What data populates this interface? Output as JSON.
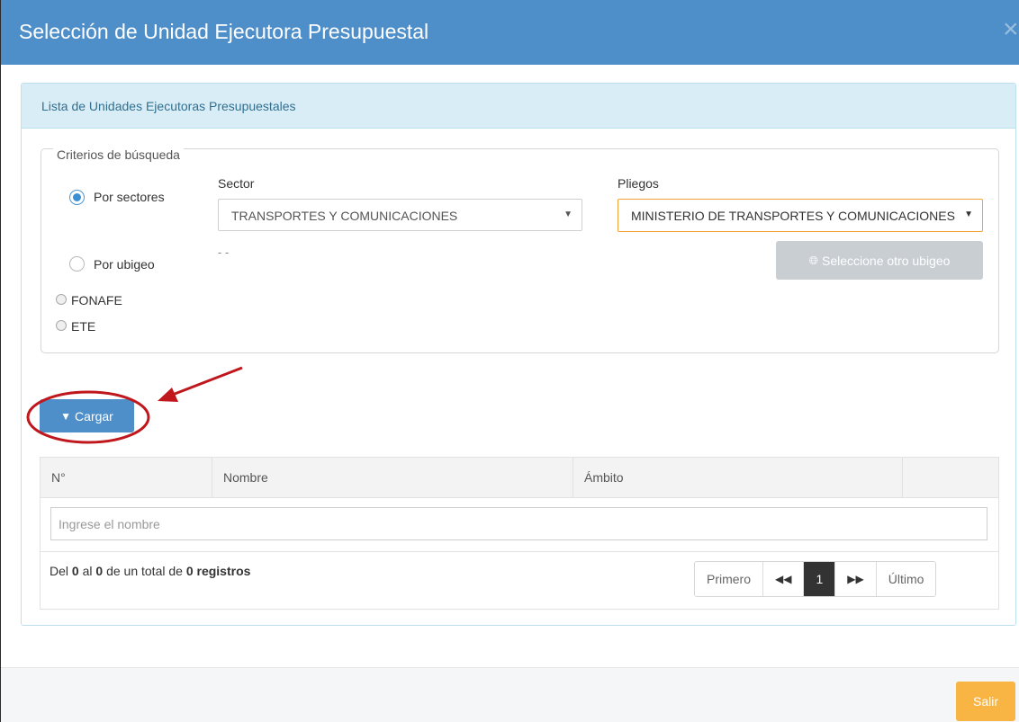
{
  "modal": {
    "title": "Selección de Unidad Ejecutora Presupuestal",
    "close_icon": "close-icon"
  },
  "panel": {
    "title": "Lista de Unidades Ejecutoras Presupuestales"
  },
  "criteria": {
    "legend": "Criterios de búsqueda",
    "radio_sectores": "Por sectores",
    "radio_ubigeo": "Por ubigeo",
    "radio_fonafe": "FONAFE",
    "radio_ete": "ETE",
    "selected_radio": "Por sectores",
    "sector_label": "Sector",
    "sector_value": "TRANSPORTES Y COMUNICACIONES",
    "ubigeo_text": "- -",
    "pliegos_label": "Pliegos",
    "pliegos_value": "MINISTERIO DE TRANSPORTES Y COMUNICACIONES",
    "ubigeo_button": "Seleccione otro ubigeo",
    "ubigeo_icon": "globe-icon"
  },
  "actions": {
    "cargar_label": "Cargar",
    "cargar_icon": "filter-icon"
  },
  "table": {
    "columns": [
      "N°",
      "Nombre",
      "Ámbito",
      ""
    ],
    "filter_placeholder": "Ingrese el nombre",
    "rows": [],
    "info": {
      "prefix": "Del ",
      "from": "0",
      "mid1": " al ",
      "to": "0",
      "mid2": " de un total de ",
      "total": "0 registros"
    },
    "pager": {
      "first": "Primero",
      "prev_icon": "double-chevron-left-icon",
      "current": "1",
      "next_icon": "double-chevron-right-icon",
      "last": "Último"
    }
  },
  "footer": {
    "salir_label": "Salir"
  },
  "colors": {
    "header": "#4e8ec9",
    "panel_heading": "#d9edf7",
    "salir": "#f9b544",
    "annotation": "#c0171c"
  }
}
